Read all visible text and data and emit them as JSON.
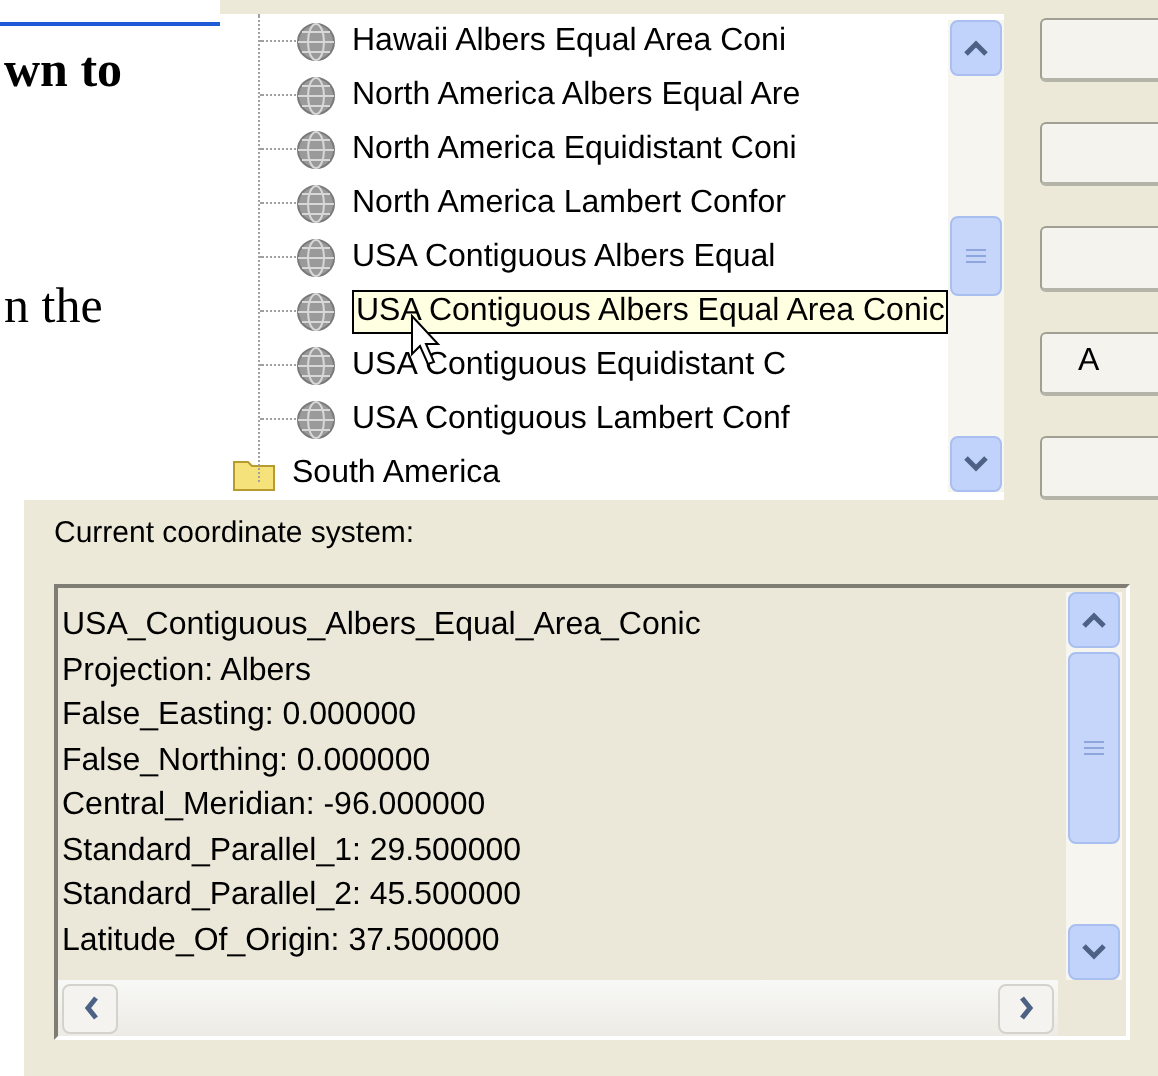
{
  "document": {
    "lines": [
      {
        "text": "wn to",
        "bold": true
      },
      {
        "text": "n the",
        "bold": false
      }
    ]
  },
  "tree": {
    "items": [
      {
        "label": "Hawaii Albers Equal Area Coni",
        "hovered": false
      },
      {
        "label": "North America Albers Equal Are",
        "hovered": false
      },
      {
        "label": "North America Equidistant Coni",
        "hovered": false
      },
      {
        "label": "North America Lambert Confor",
        "hovered": false
      },
      {
        "label": "USA Contiguous Albers Equal",
        "hovered": false
      },
      {
        "label": "USA Contiguous Albers Equal Area Conic",
        "hovered": true
      },
      {
        "label": "USA Contiguous Equidistant C",
        "hovered": false
      },
      {
        "label": "USA Contiguous Lambert Conf",
        "hovered": false
      }
    ],
    "folder": {
      "label": "South America"
    }
  },
  "side_buttons": [
    {
      "kind": "blank"
    },
    {
      "kind": "blank"
    },
    {
      "kind": "blank"
    },
    {
      "kind": "labeled",
      "label": "A"
    },
    {
      "kind": "blank"
    }
  ],
  "current_system": {
    "label": "Current coordinate system:",
    "lines": [
      "USA_Contiguous_Albers_Equal_Area_Conic",
      "Projection: Albers",
      "False_Easting: 0.000000",
      "False_Northing: 0.000000",
      "Central_Meridian: -96.000000",
      "Standard_Parallel_1: 29.500000",
      "Standard_Parallel_2: 45.500000",
      "Latitude_Of_Origin: 37.500000"
    ]
  }
}
